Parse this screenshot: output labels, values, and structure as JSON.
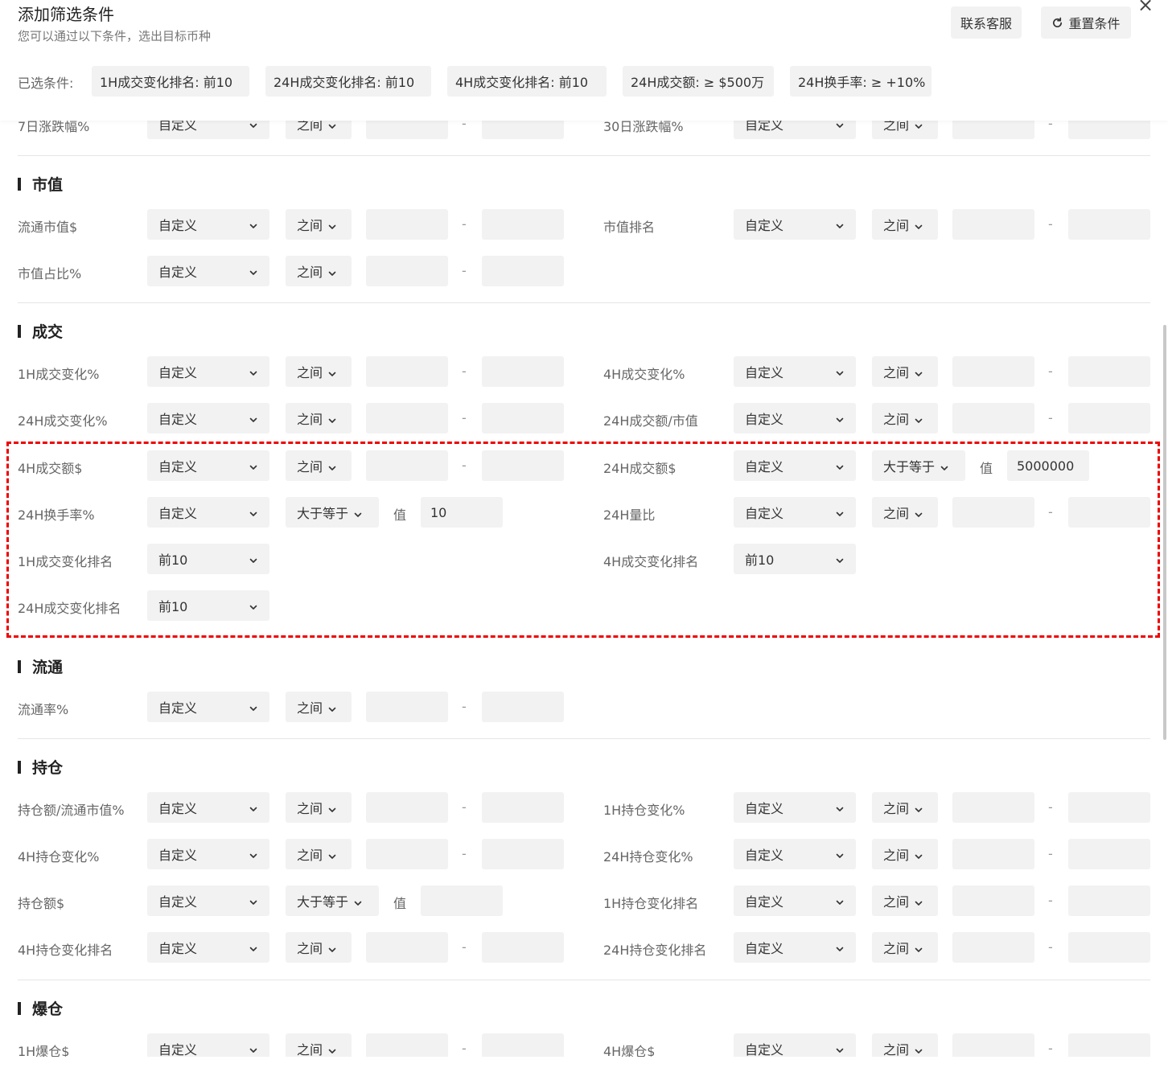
{
  "header": {
    "title": "添加筛选条件",
    "subtitle": "您可以通过以下条件，选出目标币种",
    "contact_button": "联系客服",
    "reset_button": "重置条件",
    "close_symbol": "×",
    "reset_icon": "refresh-icon"
  },
  "selected": {
    "label": "已选条件:",
    "chips": [
      "1H成交变化排名: 前10",
      "24H成交变化排名: 前10",
      "4H成交变化排名: 前10",
      "24H成交额: ≥ $500万",
      "24H换手率: ≥ +10%"
    ]
  },
  "common": {
    "custom": "自定义",
    "between": "之间",
    "gte": "大于等于",
    "value_label": "值",
    "dash": "-",
    "top10": "前10"
  },
  "rows": {
    "r7d": "7日涨跌幅%",
    "r30d": "30日涨跌幅%"
  },
  "sections": {
    "market_cap": {
      "title": "市值",
      "fields": [
        "流通市值$",
        "市值排名",
        "市值占比%"
      ]
    },
    "volume": {
      "title": "成交",
      "fields": [
        "1H成交变化%",
        "4H成交变化%",
        "24H成交变化%",
        "24H成交额/市值",
        "4H成交额$",
        "24H成交额$",
        "24H换手率%",
        "24H量比",
        "1H成交变化排名",
        "4H成交变化排名",
        "24H成交变化排名"
      ],
      "values": {
        "vol24h": "5000000",
        "turnover24h": "10"
      }
    },
    "circulation": {
      "title": "流通",
      "fields": [
        "流通率%"
      ]
    },
    "open_interest": {
      "title": "持仓",
      "fields": [
        "持仓额/流通市值%",
        "1H持仓变化%",
        "4H持仓变化%",
        "24H持仓变化%",
        "持仓额$",
        "1H持仓变化排名",
        "4H持仓变化排名",
        "24H持仓变化排名"
      ]
    },
    "liquidation": {
      "title": "爆仓",
      "fields": [
        "1H爆仓$",
        "4H爆仓$"
      ]
    }
  },
  "colors": {
    "highlight_border": "#ee0000",
    "field_bg": "#f2f2f3"
  }
}
